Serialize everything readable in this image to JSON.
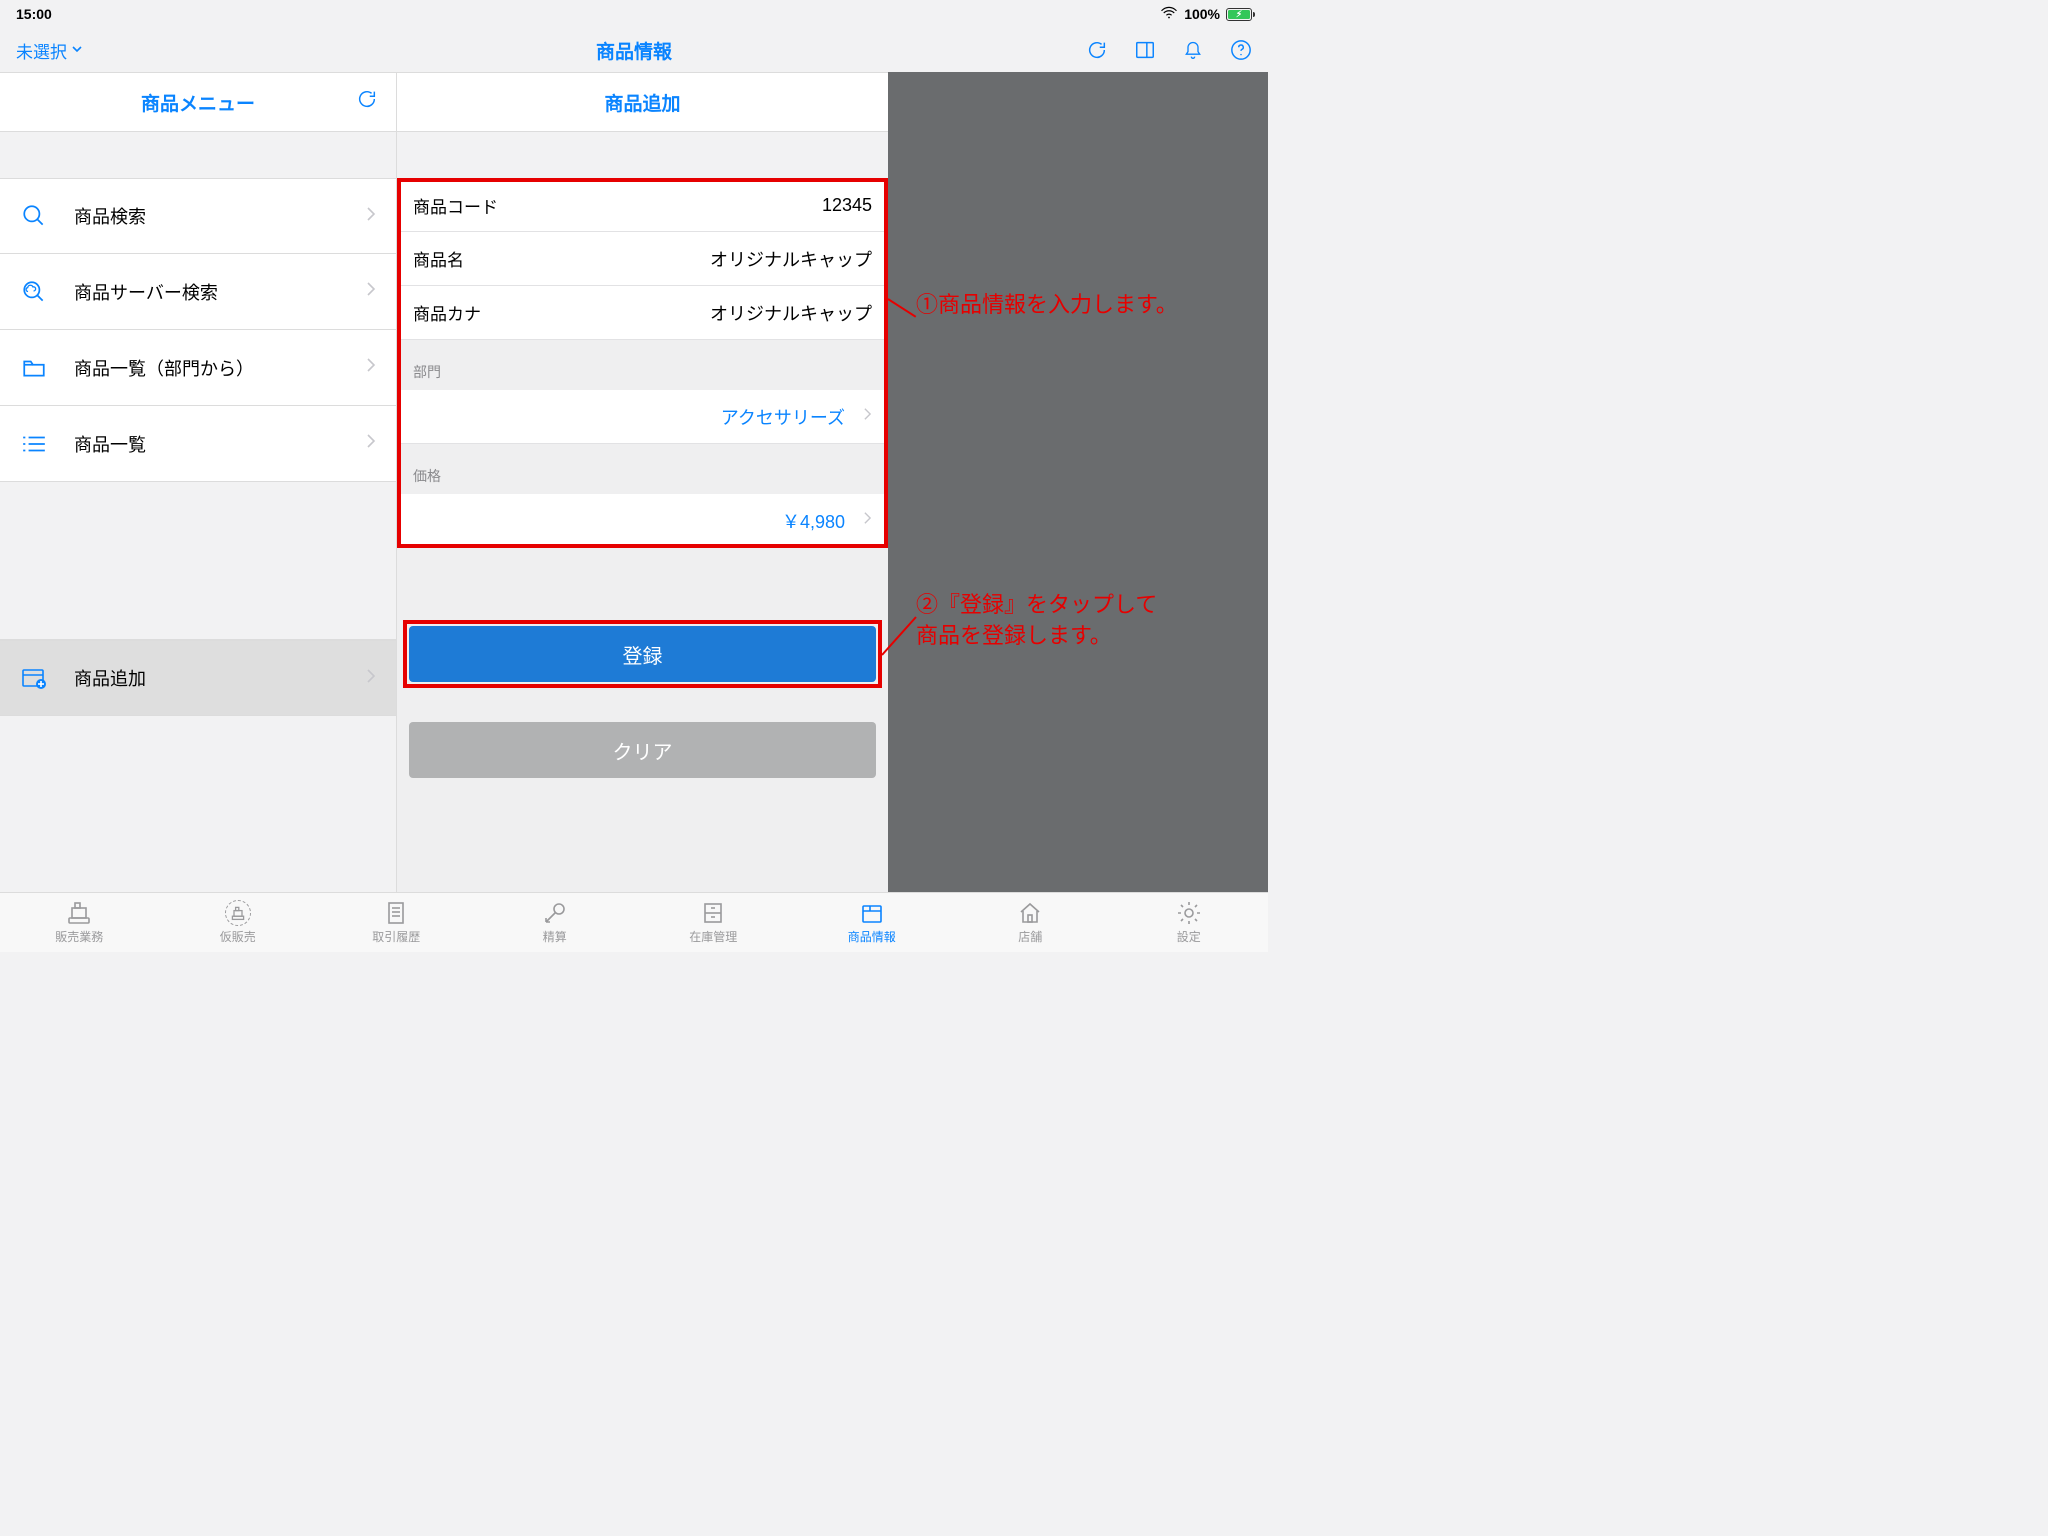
{
  "statusbar": {
    "time": "15:00",
    "battery_percent": "100%"
  },
  "nav": {
    "left_label": "未選択",
    "title": "商品情報"
  },
  "left": {
    "header": "商品メニュー",
    "items": [
      {
        "id": "search",
        "label": "商品検索"
      },
      {
        "id": "server-search",
        "label": "商品サーバー検索"
      },
      {
        "id": "list-by-dept",
        "label": "商品一覧（部門から）"
      },
      {
        "id": "list",
        "label": "商品一覧"
      }
    ],
    "bottom_item": {
      "id": "add-product",
      "label": "商品追加"
    }
  },
  "mid": {
    "header": "商品追加",
    "fields": {
      "code": {
        "label": "商品コード",
        "value": "12345"
      },
      "name": {
        "label": "商品名",
        "value": "オリジナルキャップ"
      },
      "kana": {
        "label": "商品カナ",
        "value": "オリジナルキャップ"
      }
    },
    "section_department": {
      "header": "部門",
      "value": "アクセサリーズ"
    },
    "section_price": {
      "header": "価格",
      "value": "￥4,980"
    },
    "register_button": "登録",
    "clear_button": "クリア"
  },
  "annotations": {
    "step1": "①商品情報を入力します。",
    "step2_line1": "②『登録』をタップして",
    "step2_line2": "商品を登録します。"
  },
  "tabs": [
    {
      "id": "sales",
      "label": "販売業務"
    },
    {
      "id": "suspend",
      "label": "仮販売"
    },
    {
      "id": "history",
      "label": "取引履歴"
    },
    {
      "id": "settle",
      "label": "精算"
    },
    {
      "id": "inventory",
      "label": "在庫管理"
    },
    {
      "id": "product",
      "label": "商品情報"
    },
    {
      "id": "store",
      "label": "店舗"
    },
    {
      "id": "settings",
      "label": "設定"
    }
  ]
}
